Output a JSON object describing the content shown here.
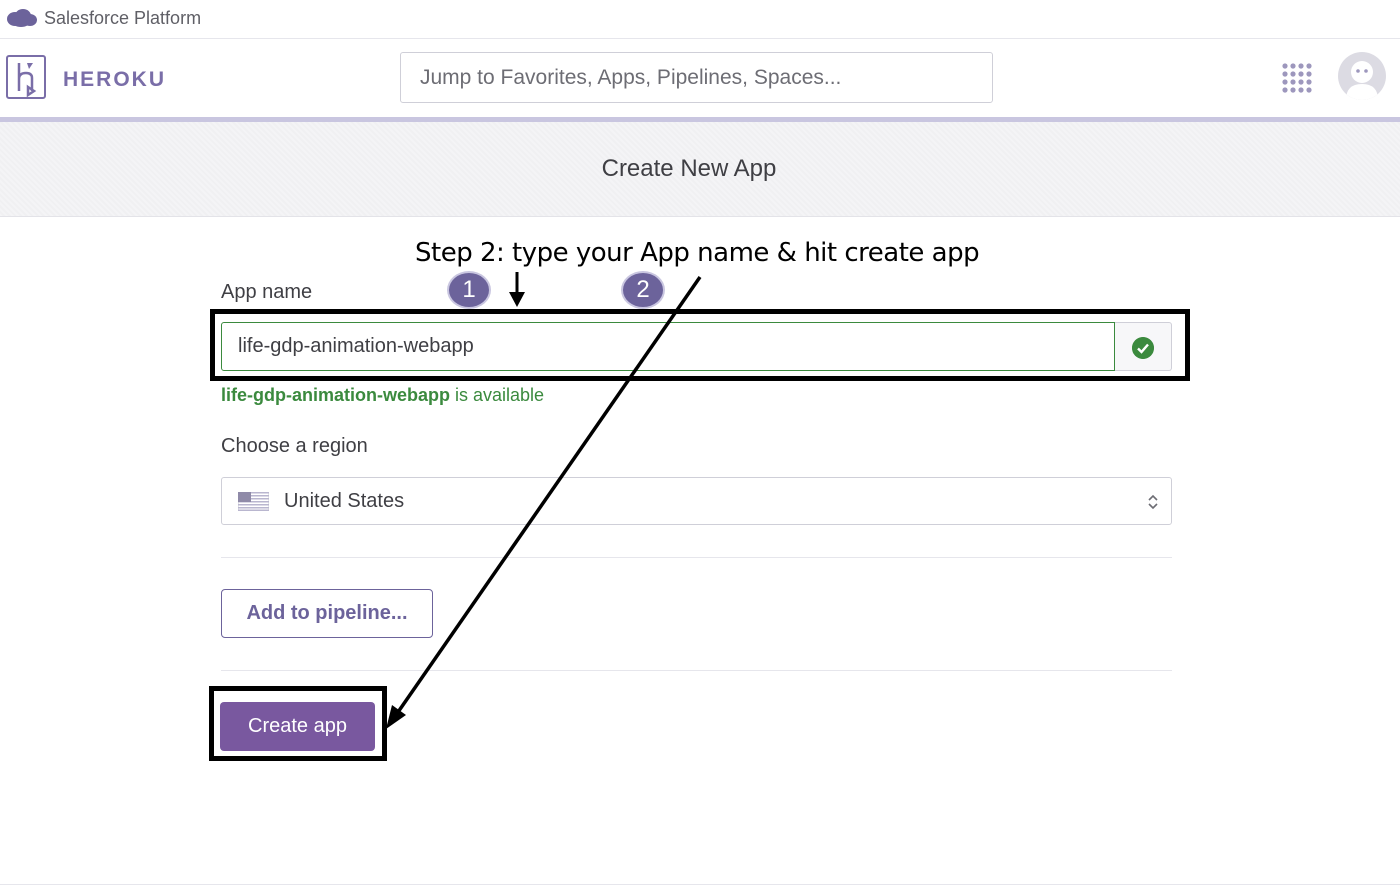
{
  "salesforce": {
    "title": "Salesforce Platform"
  },
  "header": {
    "brand": "HEROKU",
    "search_placeholder": "Jump to Favorites, Apps, Pipelines, Spaces..."
  },
  "page": {
    "title": "Create New App"
  },
  "annotation": {
    "text": "Step 2: type your App name & hit create app",
    "badge1": "1",
    "badge2": "2"
  },
  "form": {
    "app_name_label": "App name",
    "app_name_value": "life-gdp-animation-webapp",
    "availability_name": "life-gdp-animation-webapp",
    "availability_suffix": " is available",
    "region_label": "Choose a region",
    "region_value": "United States",
    "pipeline_button": "Add to pipeline...",
    "create_button": "Create app"
  },
  "colors": {
    "brand": "#79589f",
    "success": "#3b8a3e"
  },
  "icons": [
    "salesforce-cloud-icon",
    "heroku-logo-icon",
    "apps-grid-icon",
    "avatar-icon",
    "check-icon",
    "us-flag-icon",
    "updown-icon"
  ]
}
